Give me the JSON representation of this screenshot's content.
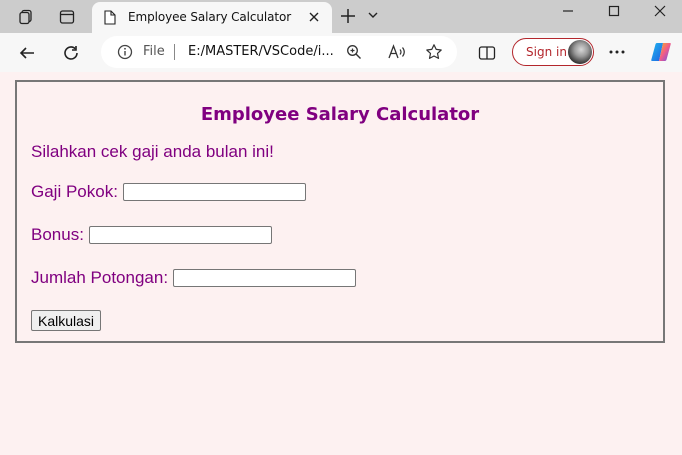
{
  "browser": {
    "tab_title": "Employee Salary Calculator",
    "file_label": "File",
    "url": "E:/MASTER/VSCode/i...",
    "signin_label": "Sign in"
  },
  "page": {
    "heading": "Employee Salary Calculator",
    "intro": "Silahkan cek gaji anda bulan ini!",
    "fields": [
      {
        "label": "Gaji Pokok:",
        "value": ""
      },
      {
        "label": "Bonus:",
        "value": ""
      },
      {
        "label": "Jumlah Potongan:",
        "value": ""
      }
    ],
    "button_label": "Kalkulasi"
  },
  "colors": {
    "accent": "#800080",
    "page_background": "#fdf1f1",
    "signin_border": "#b3262c"
  }
}
